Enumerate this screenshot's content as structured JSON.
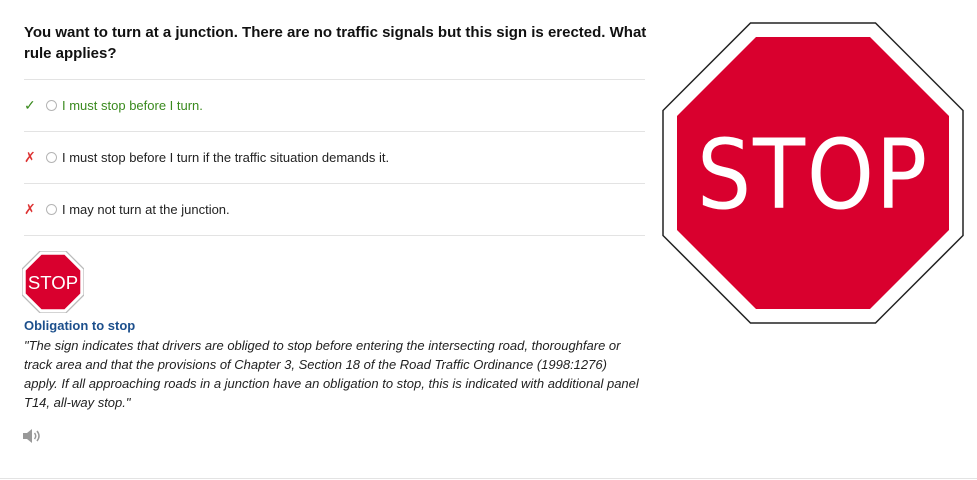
{
  "question": "You want to turn at a junction. There are no traffic signals but this sign is erected. What rule applies?",
  "answers": [
    {
      "mark": "✓",
      "text": "I must stop before I turn.",
      "status": "correct"
    },
    {
      "mark": "✗",
      "text": "I must stop before I turn if the traffic situation demands it.",
      "status": "incorrect"
    },
    {
      "mark": "✗",
      "text": "I may not turn at the junction.",
      "status": "incorrect"
    }
  ],
  "sign": {
    "text": "STOP",
    "color": "#d9002e"
  },
  "explanation": {
    "title": "Obligation to stop",
    "body": "\"The sign indicates that drivers are obliged to stop before entering the intersecting road, thoroughfare or track area and that the provisions of Chapter 3, Section 18 of the Road Traffic Ordinance (1998:1276) apply. If all approaching roads in a junction have an obligation to stop, this is indicated with additional panel T14, all-way stop.\""
  },
  "colors": {
    "correct": "#3a8a1e",
    "incorrect": "#dd3333",
    "title": "#1c4f8c"
  },
  "icons": {
    "correct": "check-icon",
    "incorrect": "cross-icon",
    "audio": "speaker-icon"
  }
}
